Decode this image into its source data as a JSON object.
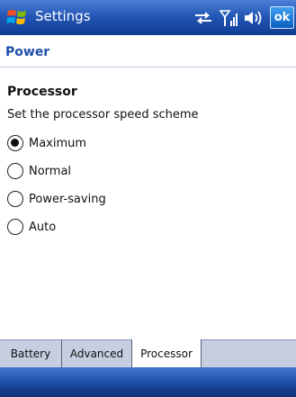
{
  "status_bar": {
    "app_title": "Settings",
    "ok_label": "ok",
    "icons": [
      "windows-start-icon",
      "sync-icon",
      "signal-icon",
      "volume-icon"
    ]
  },
  "page": {
    "title": "Power"
  },
  "processor": {
    "section_title": "Processor",
    "description": "Set the processor speed scheme",
    "options": [
      {
        "label": "Maximum",
        "selected": true
      },
      {
        "label": "Normal",
        "selected": false
      },
      {
        "label": "Power-saving",
        "selected": false
      },
      {
        "label": "Auto",
        "selected": false
      }
    ]
  },
  "tabs": [
    {
      "label": "Battery",
      "active": false
    },
    {
      "label": "Advanced",
      "active": false
    },
    {
      "label": "Processor",
      "active": true
    }
  ],
  "colors": {
    "titlebar": "#2457b6",
    "page_title": "#1e4fa7",
    "tab_strip": "#c6cee0",
    "ok_button": "#1a73d6"
  }
}
